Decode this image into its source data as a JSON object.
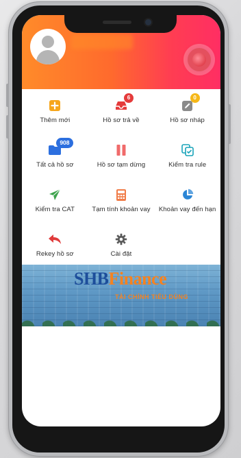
{
  "header": {
    "avatar_alt": "user-avatar",
    "accent_gradient": [
      "#ff8b2a",
      "#ff2e63"
    ]
  },
  "menu": [
    {
      "label": "Thêm mới",
      "icon": "add-square-icon",
      "color": "#f6a61c",
      "badge": ""
    },
    {
      "label": "Hồ sơ trả về",
      "icon": "inbox-tray-icon",
      "color": "#e53b3b",
      "badge": "6"
    },
    {
      "label": "Hồ sơ nháp",
      "icon": "edit-pencil-icon",
      "color": "#8a8a8a",
      "badge": "0"
    },
    {
      "label": "Tất cả hồ sơ",
      "icon": "folder-icon",
      "color": "#2c6fdf",
      "badge": "908"
    },
    {
      "label": "Hồ sơ tạm dừng",
      "icon": "pause-icon",
      "color": "#f06b6b",
      "badge": ""
    },
    {
      "label": "Kiểm tra rule",
      "icon": "copy-check-icon",
      "color": "#18a3b9",
      "badge": ""
    },
    {
      "label": "Kiểm tra CAT",
      "icon": "send-plane-icon",
      "color": "#3da34c",
      "badge": ""
    },
    {
      "label": "Tạm tính khoản vay",
      "icon": "calculator-icon",
      "color": "#f07c48",
      "badge": ""
    },
    {
      "label": "Khoản vay đến hạn",
      "icon": "pie-chart-icon",
      "color": "#2b86d6",
      "badge": ""
    },
    {
      "label": "Rekey hồ sơ",
      "icon": "reply-arrow-icon",
      "color": "#e03b3b",
      "badge": ""
    },
    {
      "label": "Cài đặt",
      "icon": "gear-icon",
      "color": "#5a5a5a",
      "badge": ""
    }
  ],
  "banner": {
    "brand_part1": "SHB",
    "brand_part2": "Finance",
    "tagline": "TÀI CHÍNH TIÊU DÙNG"
  }
}
